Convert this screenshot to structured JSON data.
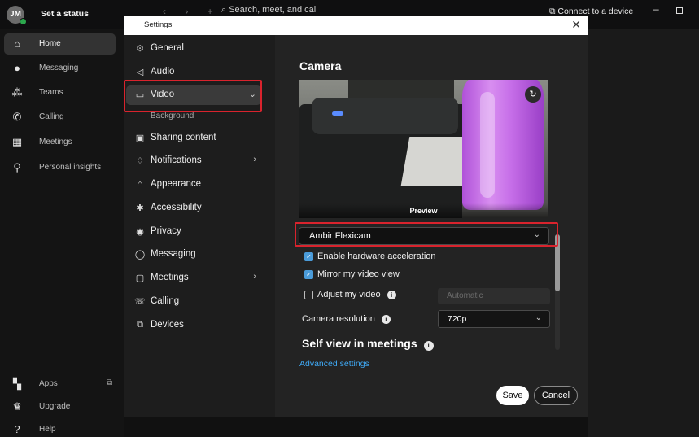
{
  "app": {
    "avatar_initials": "JM",
    "status_label": "Set a status",
    "nav_arrows": "‹ › +",
    "search_placeholder": "Search, meet, and call",
    "connect_label": "Connect to a device"
  },
  "sidebar": {
    "items": [
      {
        "label": "Home",
        "icon": "home-icon"
      },
      {
        "label": "Messaging",
        "icon": "chat-bubble-icon"
      },
      {
        "label": "Teams",
        "icon": "teams-icon"
      },
      {
        "label": "Calling",
        "icon": "phone-icon"
      },
      {
        "label": "Meetings",
        "icon": "calendar-icon"
      },
      {
        "label": "Personal insights",
        "icon": "insights-icon"
      }
    ],
    "bottom_items": [
      {
        "label": "Apps",
        "icon": "apps-grid-icon"
      },
      {
        "label": "Upgrade",
        "icon": "crown-icon"
      },
      {
        "label": "Help",
        "icon": "help-icon"
      }
    ]
  },
  "dialog": {
    "title": "Settings",
    "nav": [
      {
        "label": "General",
        "icon": "gear-icon"
      },
      {
        "label": "Audio",
        "icon": "speaker-icon"
      },
      {
        "label": "Video",
        "icon": "video-camera-icon"
      },
      {
        "sub_label": "Background"
      },
      {
        "label": "Sharing content",
        "icon": "screen-share-icon"
      },
      {
        "label": "Notifications",
        "icon": "bell-icon"
      },
      {
        "label": "Appearance",
        "icon": "appearance-icon"
      },
      {
        "label": "Accessibility",
        "icon": "accessibility-icon"
      },
      {
        "label": "Privacy",
        "icon": "privacy-icon"
      },
      {
        "label": "Messaging",
        "icon": "message-icon"
      },
      {
        "label": "Meetings",
        "icon": "meetings-icon"
      },
      {
        "label": "Calling",
        "icon": "calling-icon"
      },
      {
        "label": "Devices",
        "icon": "devices-icon"
      }
    ],
    "camera": {
      "heading": "Camera",
      "preview_label": "Preview",
      "selected_camera": "Ambir Flexicam",
      "hardware_acceleration": {
        "label": "Enable hardware acceleration",
        "checked": true
      },
      "mirror_video": {
        "label": "Mirror my video view",
        "checked": true
      },
      "adjust_video": {
        "label": "Adjust my video",
        "checked": false,
        "mode": "Automatic"
      },
      "resolution_label": "Camera resolution",
      "resolution_value": "720p",
      "self_view_heading": "Self view in meetings",
      "advanced_link": "Advanced settings"
    },
    "buttons": {
      "save": "Save",
      "cancel": "Cancel"
    }
  },
  "colors": {
    "highlight_box": "#d9232d",
    "link": "#3fa9f5",
    "checkbox_accent": "#4a9bd9"
  }
}
